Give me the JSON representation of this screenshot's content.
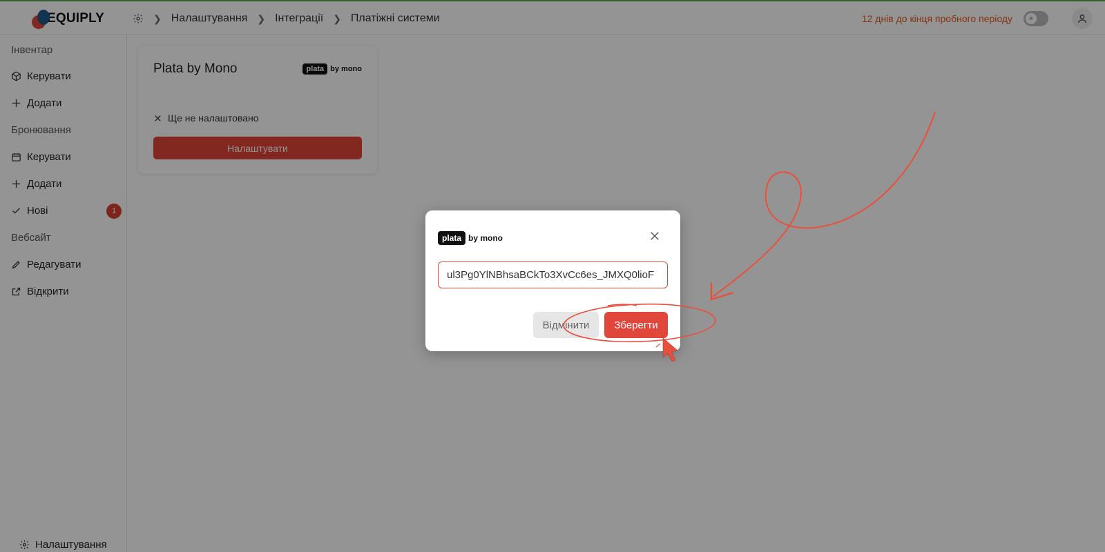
{
  "brand": {
    "name": "EQUIPLY"
  },
  "breadcrumb": {
    "items": [
      "Налаштування",
      "Інтеграції",
      "Платіжні системи"
    ]
  },
  "trial_notice": "12 днів до кінця пробного періоду",
  "sidebar": {
    "sections": [
      {
        "title": "Інвентар",
        "items": [
          {
            "label": "Керувати",
            "icon": "box-icon"
          },
          {
            "label": "Додати",
            "icon": "plus-icon"
          }
        ]
      },
      {
        "title": "Бронювання",
        "items": [
          {
            "label": "Керувати",
            "icon": "calendar-icon"
          },
          {
            "label": "Додати",
            "icon": "plus-icon"
          },
          {
            "label": "Нові",
            "icon": "check-icon",
            "badge": "1"
          }
        ]
      },
      {
        "title": "Вебсайт",
        "items": [
          {
            "label": "Редагувати",
            "icon": "pencil-icon"
          },
          {
            "label": "Відкрити",
            "icon": "external-link-icon"
          }
        ]
      }
    ],
    "settings_label": "Налаштування"
  },
  "card": {
    "title": "Plata by Mono",
    "logo_box": "plata",
    "logo_by": "by mono",
    "status": "Ще не налаштовано",
    "button": "Налаштувати"
  },
  "modal": {
    "logo_box": "plata",
    "logo_by": "by mono",
    "input_value": "ul3Pg0YlNBhsaBCkTo3XvCc6es_JMXQ0lioF",
    "cancel_label": "Відмінити",
    "save_label": "Зберегти"
  },
  "colors": {
    "accent": "#e0463a",
    "trial": "#e05a1a",
    "overlay": "rgba(0,0,0,0.42)"
  }
}
